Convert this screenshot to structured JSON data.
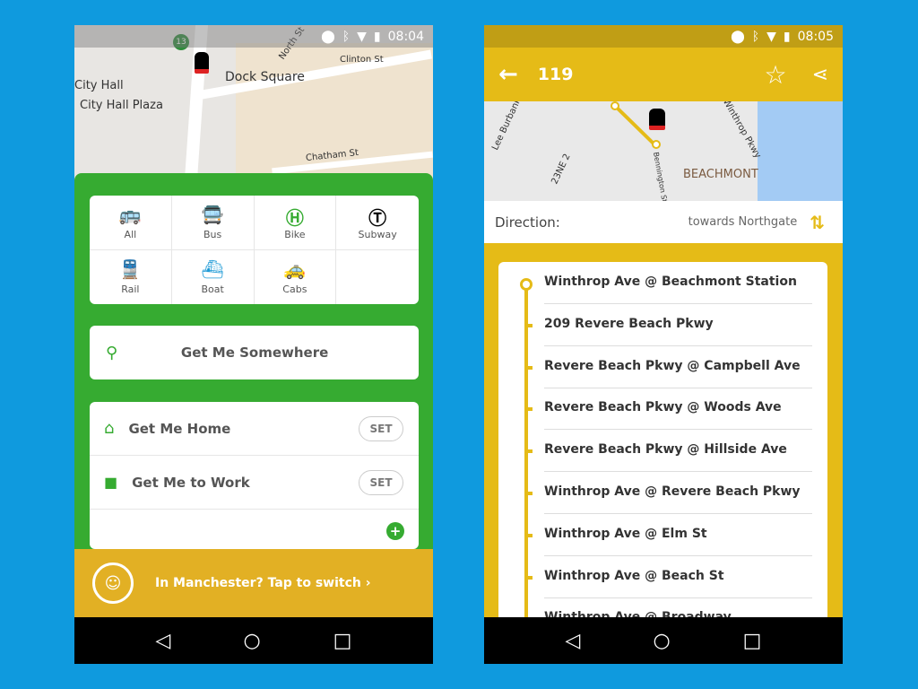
{
  "left_phone": {
    "status": {
      "time": "08:04"
    },
    "map": {
      "labels": [
        "Dock Square",
        "City Hall",
        "City Hall Plaza",
        "North St",
        "Clinton St",
        "Chatham St"
      ],
      "bike_count": "13"
    },
    "modes": [
      {
        "label": "All",
        "icon": "all-modes-icon",
        "color": "#2c6aa0"
      },
      {
        "label": "Bus",
        "icon": "bus-icon",
        "color": "#f2c31b"
      },
      {
        "label": "Bike",
        "icon": "bike-share-icon",
        "color": "#36ab31"
      },
      {
        "label": "Subway",
        "icon": "subway-t-icon",
        "color": "#000000"
      },
      {
        "label": "Rail",
        "icon": "rail-icon",
        "color": "#8b1c7a"
      },
      {
        "label": "Boat",
        "icon": "boat-icon",
        "color": "#1e9ad6"
      },
      {
        "label": "Cabs",
        "icon": "taxi-icon",
        "color": "#666666"
      }
    ],
    "search_label": "Get Me Somewhere",
    "favorites": [
      {
        "label": "Get Me Home",
        "icon": "home-icon",
        "button": "SET"
      },
      {
        "label": "Get Me to Work",
        "icon": "briefcase-icon",
        "button": "SET"
      }
    ],
    "banner": "In Manchester? Tap to switch ›",
    "accent": "#36ab31"
  },
  "right_phone": {
    "status": {
      "time": "08:05"
    },
    "title": "119",
    "map": {
      "labels": [
        "BEACHMONT",
        "Winthrop Pkwy",
        "Lee Burbank",
        "23NE 2",
        "Bennington St"
      ]
    },
    "direction_label": "Direction:",
    "direction_value": "towards Northgate",
    "stops": [
      "Winthrop Ave @ Beachmont Station",
      "209 Revere Beach Pkwy",
      "Revere Beach Pkwy @ Campbell Ave",
      "Revere Beach Pkwy @ Woods Ave",
      "Revere Beach Pkwy @ Hillside Ave",
      "Winthrop Ave @ Revere Beach Pkwy",
      "Winthrop Ave @ Elm St",
      "Winthrop Ave @ Beach St",
      "Winthrop Ave @ Broadway"
    ],
    "accent": "#e5bb17"
  }
}
